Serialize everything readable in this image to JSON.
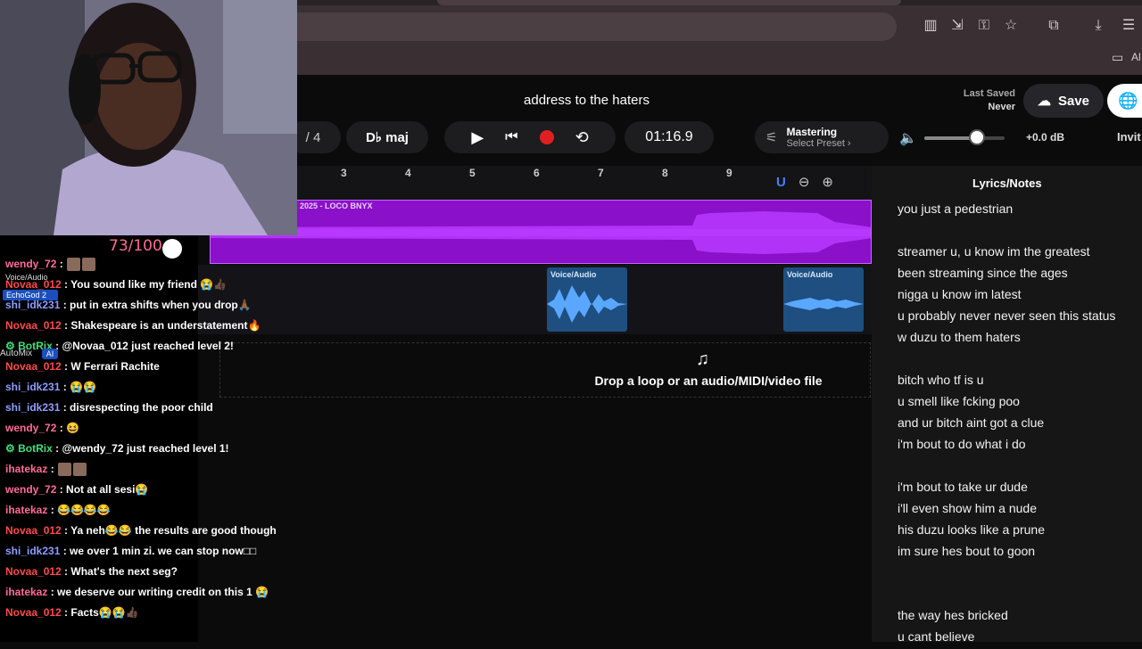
{
  "browser": {
    "bookmarks_label": "Al",
    "icons": [
      "reader-icon",
      "install-icon",
      "key-icon",
      "star-icon",
      "extensions-icon",
      "download-icon",
      "menu-icon"
    ]
  },
  "header": {
    "project_title": "address to the haters",
    "last_saved_label": "Last Saved",
    "last_saved_value": "Never",
    "save_label": "Save",
    "time_signature": "/ 4",
    "key": "D♭ maj",
    "time": "01:16.9",
    "mastering_title": "Mastering",
    "mastering_preset": "Select Preset ›",
    "volume_db": "+0.0 dB",
    "invite_label": "Invit",
    "volume_level": 0.65
  },
  "ruler": {
    "bars": [
      "3",
      "4",
      "5",
      "6",
      "7",
      "8",
      "9"
    ]
  },
  "tracks": {
    "main_clip_label": "2025 - LOCO  BNYX",
    "main_clip_color": "#8b10c9",
    "voice_clips": [
      {
        "label": "Voice/Audio"
      },
      {
        "label": "Voice/Audio"
      }
    ],
    "drop_text": "Drop a loop or an audio/MIDI/video file"
  },
  "lyrics": {
    "header": "Lyrics/Notes",
    "lines": [
      "you just a pedestrian",
      "",
      "streamer u, u know im the greatest",
      "been streaming since the ages",
      "nigga u know im latest",
      "u probably never never seen this status",
      "w duzu to them haters",
      "",
      "bitch who tf is u",
      "u smell like fcking poo",
      "and ur bitch aint got a clue",
      "i'm bout to do what i do",
      "",
      "i'm bout to take ur dude",
      "i'll even show him a nude",
      "his duzu looks like a prune",
      "im sure hes bout to goon",
      "",
      "",
      "the way hes bricked",
      "u cant believe"
    ]
  },
  "overlay": {
    "score": "73/100",
    "track_head": "Voice/Audio",
    "echo_tag": "EchoGod 2",
    "automix": "AutoMix",
    "ai_tag": "AI"
  },
  "chat": [
    {
      "user": "wendy_72",
      "color": "#ff6b9a",
      "text": ""
    },
    {
      "user": "Novaa_012",
      "color": "#ff4a4a",
      "text": "You sound like my friend 😭👍🏿"
    },
    {
      "user": "shi_idk231",
      "color": "#8f9dff",
      "text": "put in extra shifts when you drop🙏🏾"
    },
    {
      "user": "Novaa_012",
      "color": "#ff4a4a",
      "text": "Shakespeare is an understatement🔥"
    },
    {
      "user": "BotRix",
      "color": "#3ee07a",
      "text": "@Novaa_012 just reached level 2!"
    },
    {
      "user": "Novaa_012",
      "color": "#ff4a4a",
      "text": "W Ferrari Rachite"
    },
    {
      "user": "shi_idk231",
      "color": "#8f9dff",
      "text": "😭😭"
    },
    {
      "user": "shi_idk231",
      "color": "#8f9dff",
      "text": "disrespecting the poor child"
    },
    {
      "user": "wendy_72",
      "color": "#ff6b9a",
      "text": "😆"
    },
    {
      "user": "BotRix",
      "color": "#3ee07a",
      "text": "@wendy_72 just reached level 1!"
    },
    {
      "user": "ihatekaz",
      "color": "#ff6b9a",
      "text": ""
    },
    {
      "user": "wendy_72",
      "color": "#ff6b9a",
      "text": "Not at all sesi😭"
    },
    {
      "user": "ihatekaz",
      "color": "#ff6b9a",
      "text": "😂😂😂😂"
    },
    {
      "user": "Novaa_012",
      "color": "#ff4a4a",
      "text": "Ya neh😂😂 the results are good though"
    },
    {
      "user": "shi_idk231",
      "color": "#8f9dff",
      "text": "we over 1 min zi. we can stop now□□"
    },
    {
      "user": "Novaa_012",
      "color": "#ff4a4a",
      "text": "What's the next seg?"
    },
    {
      "user": "ihatekaz",
      "color": "#ff6b9a",
      "text": "we deserve our writing credit on this 1 😭"
    },
    {
      "user": "Novaa_012",
      "color": "#ff4a4a",
      "text": "Facts😭😭👍🏿"
    }
  ]
}
